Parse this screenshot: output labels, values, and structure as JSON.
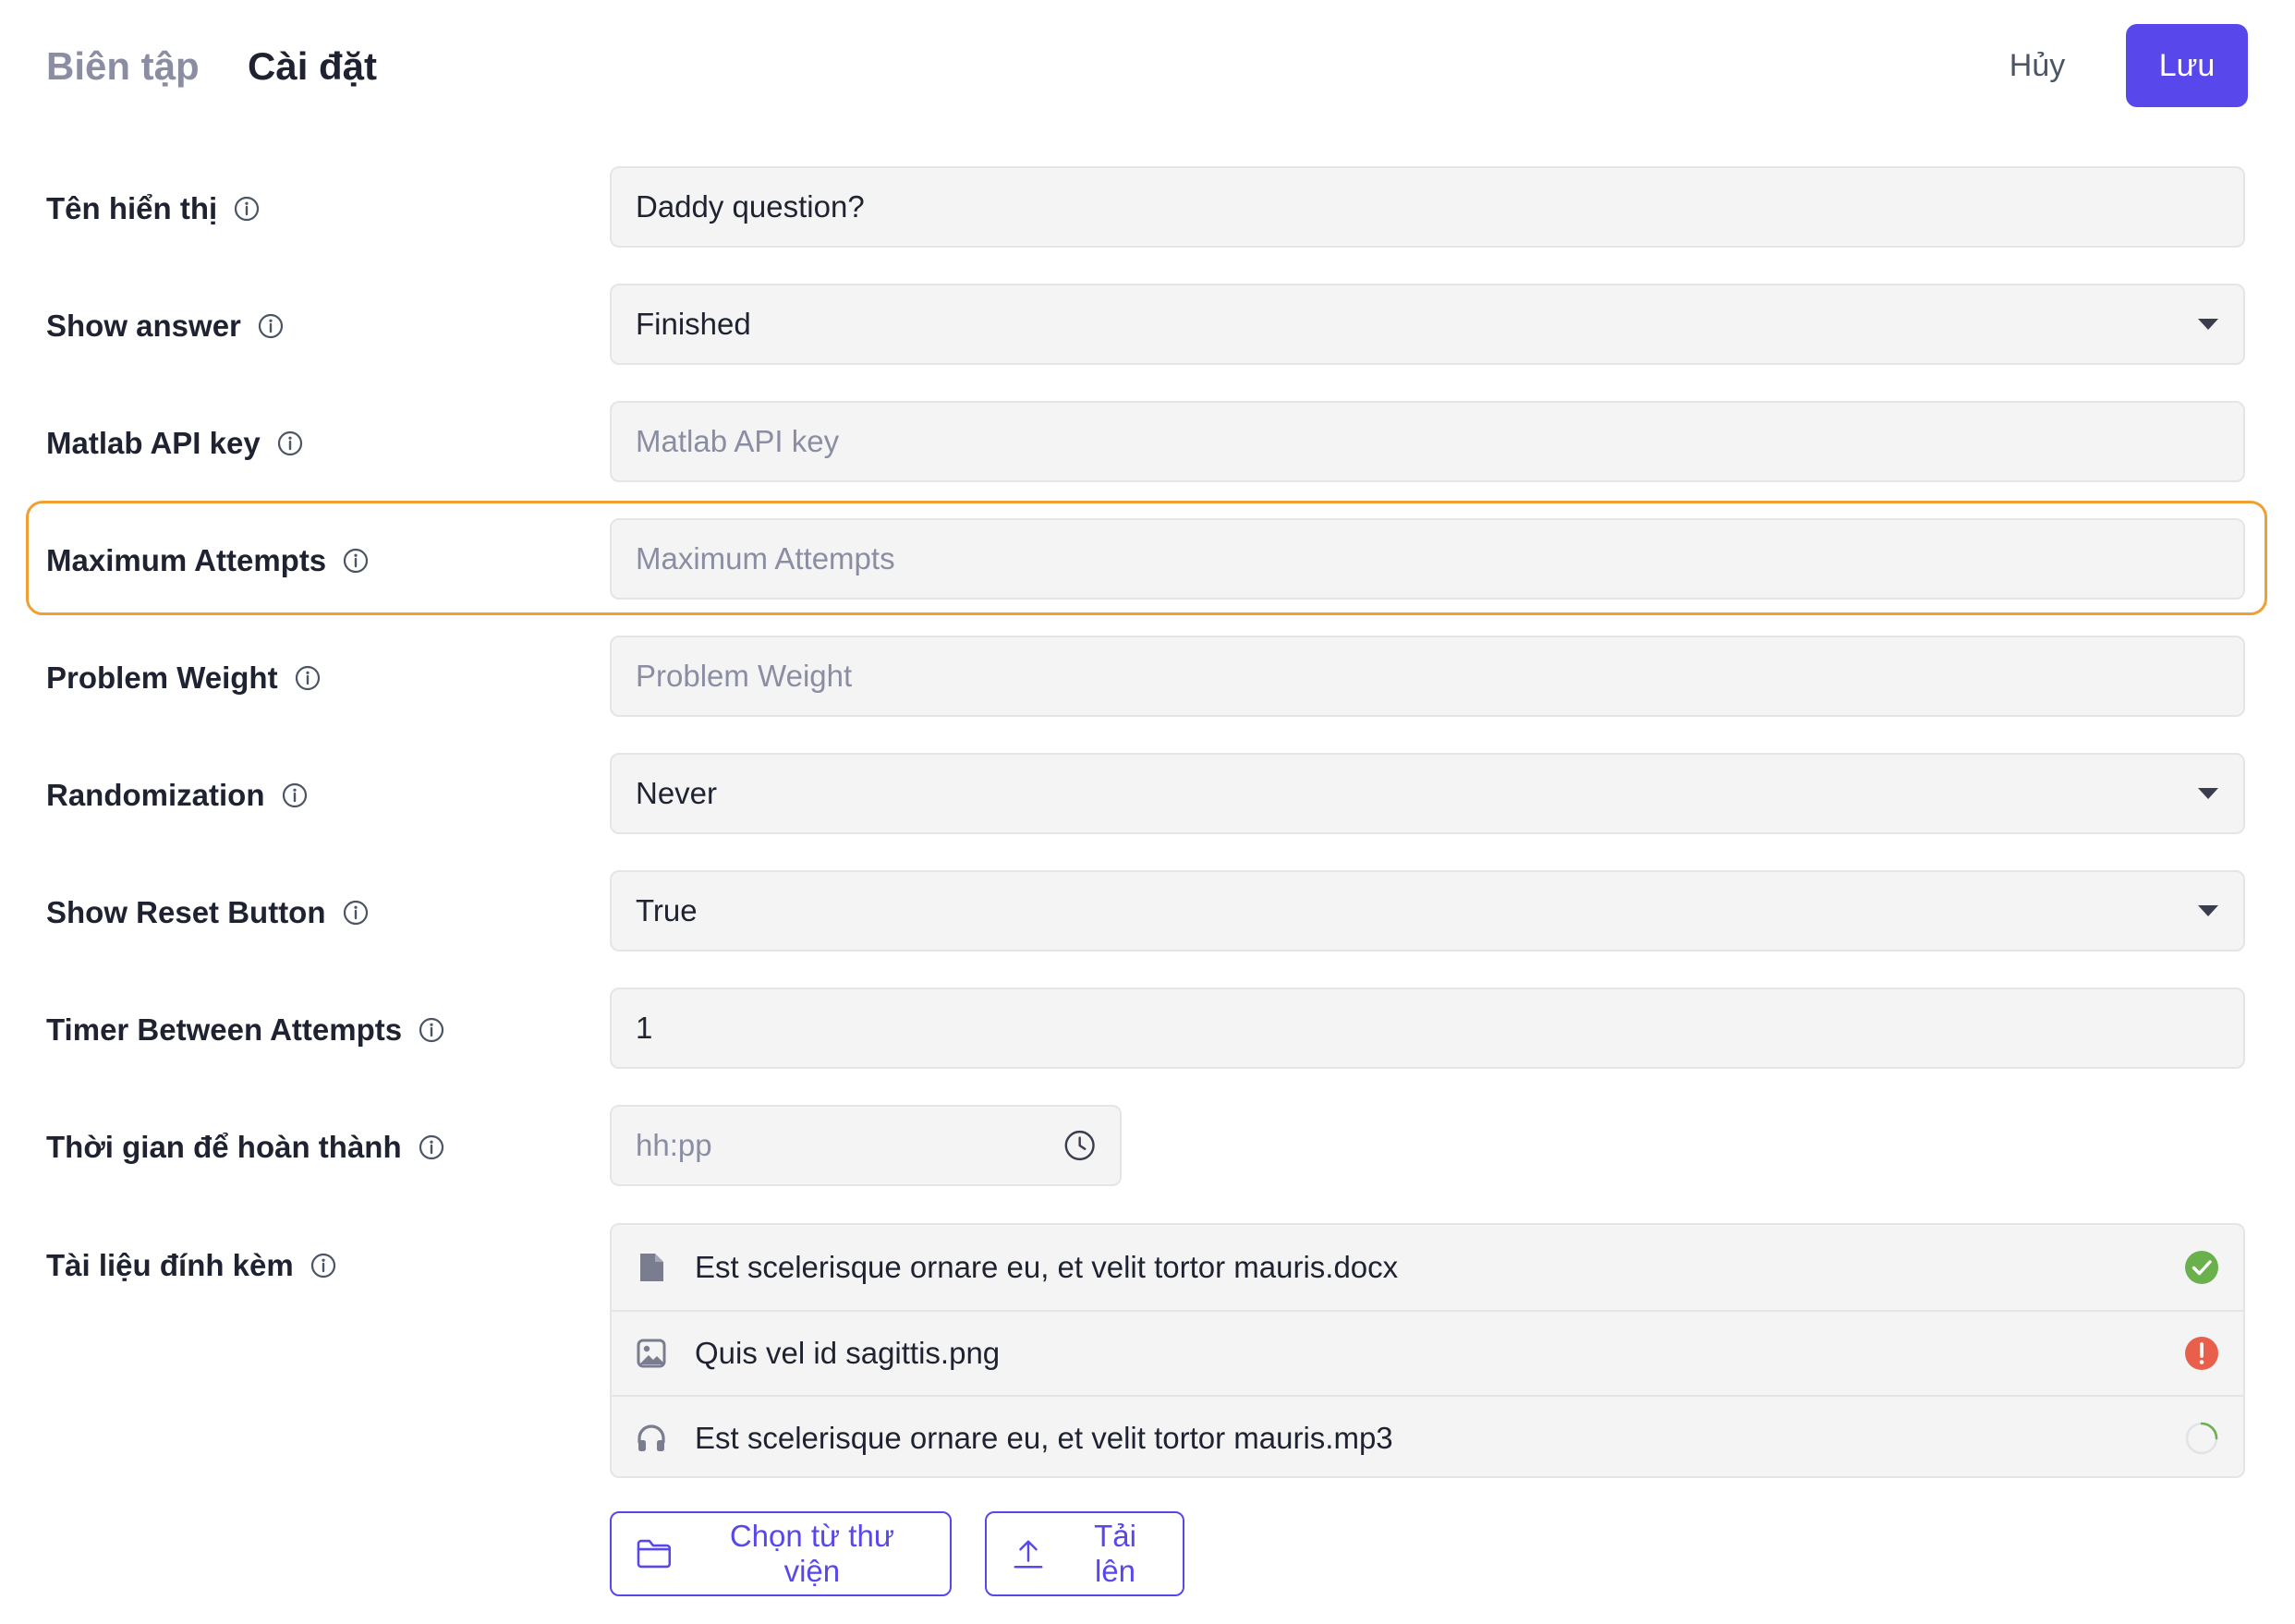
{
  "header": {
    "tabs": [
      {
        "label": "Biên tập"
      },
      {
        "label": "Cài đặt"
      }
    ],
    "cancel_label": "Hủy",
    "save_label": "Lưu"
  },
  "form": {
    "display_name": {
      "label": "Tên hiển thị",
      "value": "Daddy question?"
    },
    "show_answer": {
      "label": "Show answer",
      "value": "Finished"
    },
    "matlab_api_key": {
      "label": "Matlab API key",
      "placeholder": "Matlab API key"
    },
    "maximum_attempts": {
      "label": "Maximum Attempts",
      "placeholder": "Maximum Attempts"
    },
    "problem_weight": {
      "label": "Problem Weight",
      "placeholder": "Problem Weight"
    },
    "randomization": {
      "label": "Randomization",
      "value": "Never"
    },
    "show_reset_button": {
      "label": "Show Reset Button",
      "value": "True"
    },
    "timer_between_attempts": {
      "label": "Timer Between Attempts",
      "value": "1"
    },
    "completion_time": {
      "label": "Thời gian để hoàn thành",
      "placeholder": "hh:pp"
    },
    "attachments": {
      "label": "Tài liệu đính kèm",
      "files": [
        {
          "name": "Est scelerisque ornare eu, et velit tortor mauris.docx",
          "type_icon": "document-icon",
          "status": "success"
        },
        {
          "name": "Quis vel id sagittis.png",
          "type_icon": "image-icon",
          "status": "error"
        },
        {
          "name": "Est scelerisque ornare eu, et velit tortor mauris.mp3",
          "type_icon": "headphones-icon",
          "status": "loading"
        }
      ],
      "library_button": "Chọn từ thư viện",
      "upload_button": "Tải lên"
    }
  },
  "colors": {
    "primary": "#5848ec",
    "highlight": "#f0a032",
    "success": "#6ab04c",
    "error": "#e8604c",
    "field_bg": "#f4f4f5"
  }
}
